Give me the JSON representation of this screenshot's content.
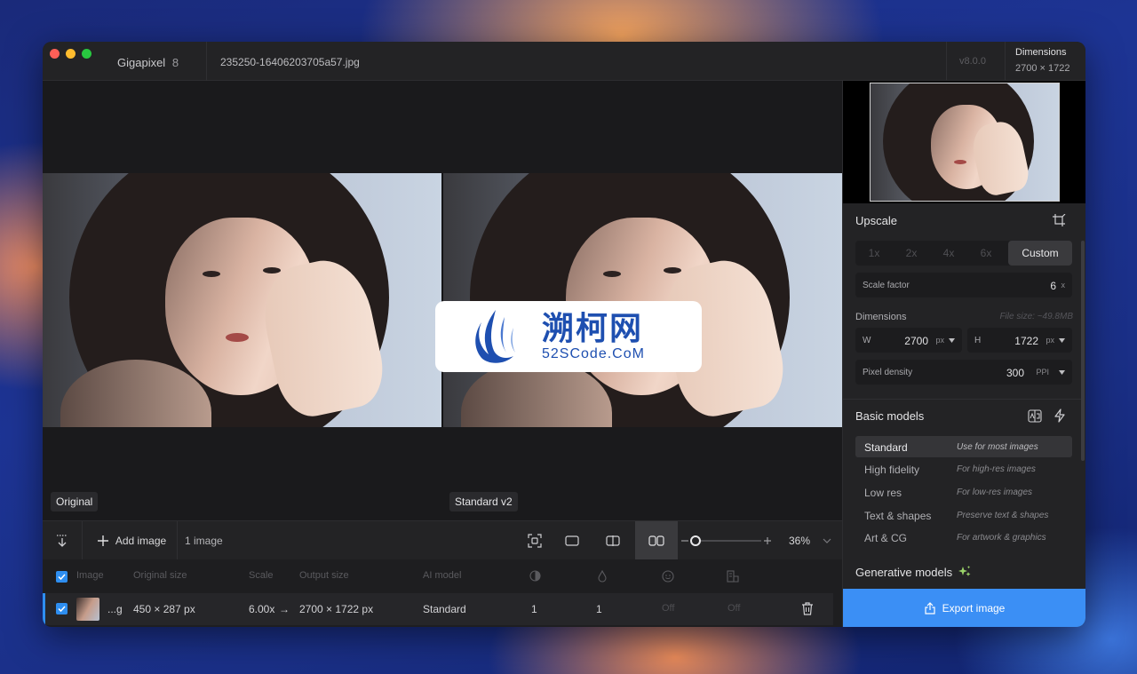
{
  "window": {
    "app_name": "Gigapixel",
    "app_version_badge": "8",
    "file_name": "235250-16406203705a57.jpg",
    "version": "v8.0.0",
    "dimensions_label": "Dimensions",
    "dimensions_value": "2700 × 1722"
  },
  "canvas": {
    "left_label": "Original",
    "right_label": "Standard v2"
  },
  "watermark": {
    "title": "溯柯网",
    "subtitle": "52SCode.CoM"
  },
  "toolbar": {
    "add_image_label": "Add image",
    "image_count": "1 image",
    "zoom_level": 0.36,
    "zoom_label": "36%"
  },
  "table": {
    "headers": [
      "Image",
      "Original size",
      "Scale",
      "Output size",
      "AI model"
    ],
    "row": {
      "name": "...g",
      "original_size": "450 × 287 px",
      "scale": "6.00x",
      "arrow": "→",
      "output_size": "2700 × 1722 px",
      "model": "Standard",
      "c1": "1",
      "c2": "1",
      "c3": "Off",
      "c4": "Off"
    }
  },
  "sidebar": {
    "upscale_title": "Upscale",
    "scale_options": [
      "1x",
      "2x",
      "4x",
      "6x",
      "Custom"
    ],
    "active_scale": "Custom",
    "scale_factor_label": "Scale factor",
    "scale_factor_value": "6",
    "scale_factor_unit": "x",
    "dimensions_title": "Dimensions",
    "file_size": "File size: ~49.8MB",
    "width_label": "W",
    "width_value": "2700",
    "width_unit": "px",
    "height_label": "H",
    "height_value": "1722",
    "height_unit": "px",
    "density_label": "Pixel density",
    "density_value": "300",
    "density_unit": "PPI",
    "basic_models_title": "Basic models",
    "models": [
      {
        "name": "Standard",
        "desc": "Use for most images"
      },
      {
        "name": "High fidelity",
        "desc": "For high-res images"
      },
      {
        "name": "Low res",
        "desc": "For low-res images"
      },
      {
        "name": "Text & shapes",
        "desc": "Preserve text & shapes"
      },
      {
        "name": "Art & CG",
        "desc": "For artwork & graphics"
      }
    ],
    "generative_models_title": "Generative models",
    "export_label": "Export image"
  },
  "colors": {
    "accent": "#3b8ff5",
    "close": "#ff5f57",
    "minimize": "#febc2e",
    "maximize": "#28c840",
    "generative_icon": "#9bd36a"
  }
}
